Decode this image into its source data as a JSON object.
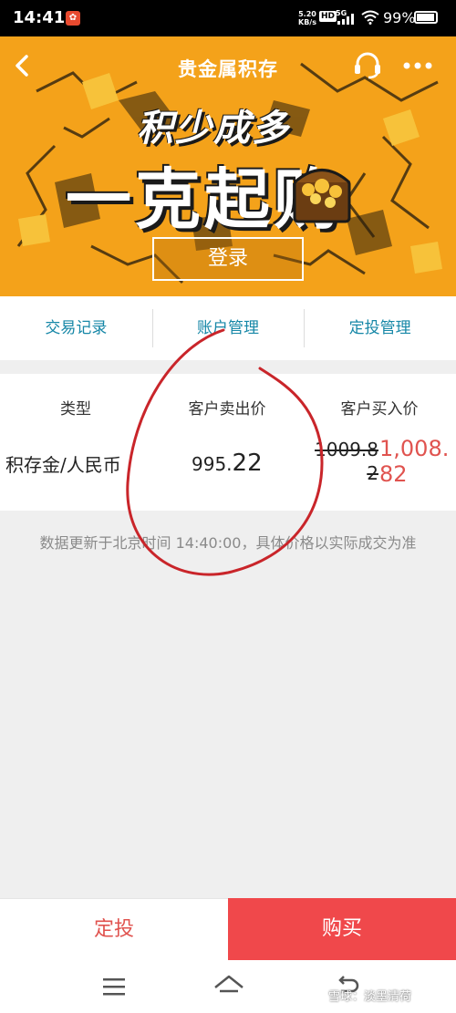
{
  "status_bar": {
    "time": "14:41",
    "network_speed": "5.20\nKB/s",
    "hd": "HD",
    "signal": "5G",
    "battery": "99%"
  },
  "header": {
    "title": "贵金属积存",
    "back_icon": "chevron-left-icon",
    "support_icon": "headset-icon",
    "more_icon": "more-dots-icon"
  },
  "banner": {
    "slogan_line1": "积少成多",
    "slogan_line2": "一克起购",
    "login_label": "登录",
    "background_color": "#f4a21a"
  },
  "tabs": [
    {
      "label": "交易记录"
    },
    {
      "label": "账户管理"
    },
    {
      "label": "定投管理"
    }
  ],
  "price_table": {
    "headers": [
      "类型",
      "客户卖出价",
      "客户买入价"
    ],
    "row": {
      "type": "积存金/人民币",
      "sell_price_main": "995.",
      "sell_price_decimal": "22",
      "buy_price_old": "1009.82",
      "buy_price_new": "1,008.82"
    }
  },
  "notice": "数据更新于北京时间 14:40:00，具体价格以实际成交为准",
  "bottom_buttons": {
    "plan_label": "定投",
    "buy_label": "购买"
  },
  "watermark": "雪球：淡墨清荷",
  "colors": {
    "accent_red": "#f0484b",
    "tab_text": "#1687a7",
    "price_up": "#e0534f"
  }
}
